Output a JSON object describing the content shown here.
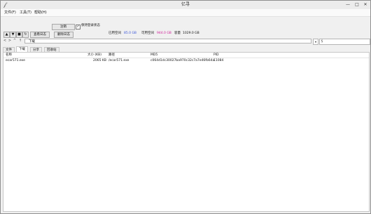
{
  "window": {
    "title": "亿寻",
    "app_icon": "feather-icon",
    "controls": [
      "—",
      "□",
      "✕"
    ]
  },
  "menu": [
    "文件(F)",
    "工具(T)",
    "帮助(H)"
  ],
  "account": {
    "logout_label": "注销",
    "remember_label": "保持登录状态",
    "remember_checked": true
  },
  "toolbar": {
    "up_glyph": "▲",
    "down_glyph": "▼",
    "stop_glyph": "■",
    "refresh_glyph": "↻",
    "view_log_label": "查看日志",
    "delete_log_label": "删除日志"
  },
  "storage": {
    "used_label": "已用空间",
    "used_value": "85.0 GB",
    "free_label": "可用空间",
    "free_value": "944.0 GB",
    "capacity_label": "容量",
    "capacity_value": "1029.0 GB"
  },
  "colors": {
    "used": "#3a55d8",
    "free": "#d0209a"
  },
  "navigation": {
    "back": "<",
    "forward": ">",
    "up": "^",
    "folder_up": "↑",
    "path": "下载",
    "dropdown": "▾",
    "search_placeholder": ""
  },
  "tabs": [
    "文件",
    "下载",
    "分享",
    "回收站"
  ],
  "active_tab": 1,
  "table": {
    "columns": [
      "名称",
      "大小 (KB)",
      "路径",
      "MD5",
      "PID"
    ],
    "rows": [
      [
        "ecar571.exe",
        "2065 KB",
        "/ecar571.exe",
        "c064d1dc30027ba970c32c7a7e46fb64a",
        "11084"
      ]
    ]
  }
}
